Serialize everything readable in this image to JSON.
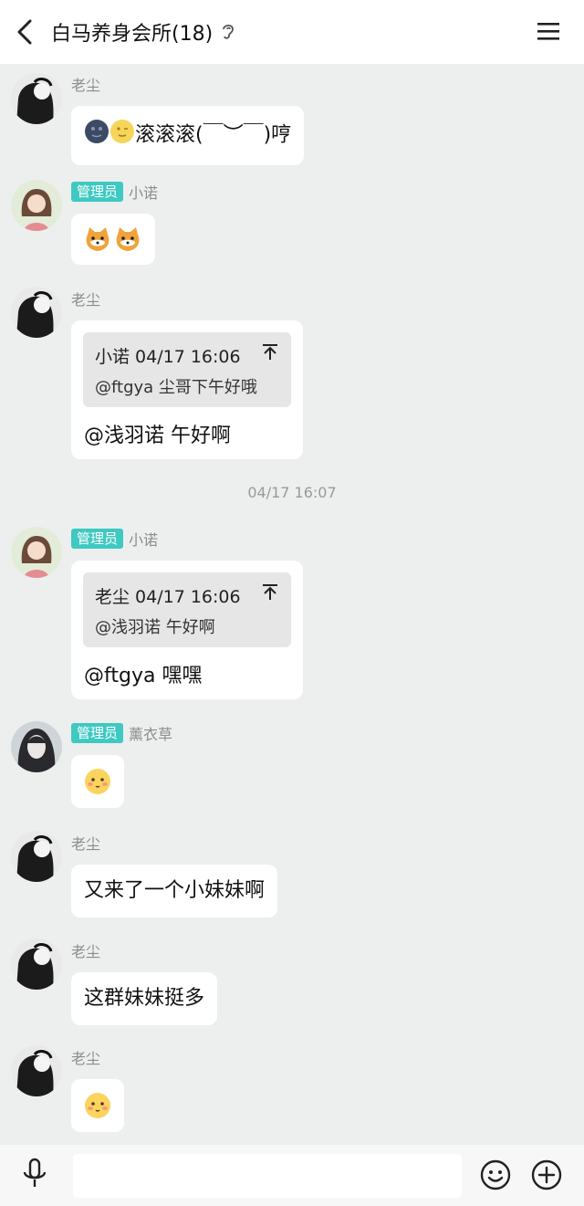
{
  "header": {
    "title": "白马养身会所(18)",
    "back_icon": "chevron-left-icon",
    "ear_icon": "ear-icon",
    "menu_icon": "hamburger-menu-icon"
  },
  "messages": [
    {
      "sender": "老尘",
      "text": "滚滚滚(￣︶￣)哼",
      "emojis": [
        "dark-moon-face-icon",
        "moon-face-icon"
      ]
    },
    {
      "sender": "小诺",
      "badge": "管理员",
      "emojis": [
        "shiba-dog-icon",
        "shiba-dog-icon"
      ]
    },
    {
      "sender": "老尘",
      "quote": {
        "head": "小诺 04/17 16:06",
        "body": "@ftgya 尘哥下午好哦"
      },
      "text": "@浅羽诺 午好啊"
    },
    {
      "sender": "小诺",
      "badge": "管理员",
      "quote": {
        "head": "老尘 04/17 16:06",
        "body": "@浅羽诺 午好啊"
      },
      "text": "@ftgya 嘿嘿"
    },
    {
      "sender": "薰衣草",
      "badge": "管理员",
      "emojis": [
        "blush-face-icon"
      ]
    },
    {
      "sender": "老尘",
      "text": "又来了一个小妹妹啊"
    },
    {
      "sender": "老尘",
      "text": "这群妹妹挺多"
    },
    {
      "sender": "老尘",
      "emojis": [
        "blush-face-icon"
      ]
    }
  ],
  "timestamp": "04/17 16:07",
  "input": {
    "placeholder": ""
  },
  "colors": {
    "badge": "#3ec9c2",
    "chat_bg": "#ecefee",
    "bubble": "#ffffff"
  }
}
